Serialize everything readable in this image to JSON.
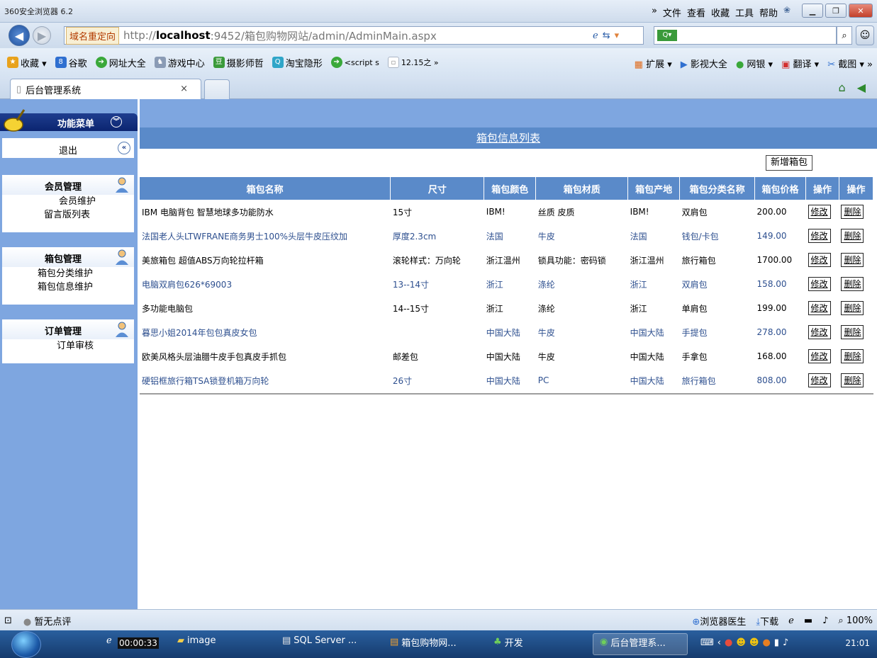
{
  "browser": {
    "title": "360安全浏览器 6.2",
    "menus": [
      "»",
      "文件",
      "查看",
      "收藏",
      "工具",
      "帮助"
    ],
    "redirect_label": "域名重定向",
    "url_pre": "http://",
    "url_host": "localhost",
    "url_rest": ":9452/箱包购物网站/admin/AdminMain.aspx",
    "favorites": [
      {
        "label": "收藏 ▾",
        "icon": "star-icon",
        "color": "#e8a21c"
      },
      {
        "label": "谷歌",
        "icon": "google-icon",
        "color": "#2f6fd0"
      },
      {
        "label": "网址大全",
        "icon": "web-icon",
        "color": "#3aa83a"
      },
      {
        "label": "游戏中心",
        "icon": "game-icon",
        "color": "#8a9bb5"
      },
      {
        "label": "摄影师哲",
        "icon": "douban-icon",
        "color": "#3a9a3a"
      },
      {
        "label": "淘宝隐形",
        "icon": "taobao-icon",
        "color": "#2fa5c8"
      },
      {
        "label": "<script s",
        "icon": "web-icon",
        "color": "#3aa83a"
      },
      {
        "label": "12.15之 »",
        "icon": "page-icon",
        "color": "#aab5c5"
      }
    ],
    "fav_right": [
      "扩展 ▾",
      "影视大全",
      "网银 ▾",
      "翻译 ▾",
      "截图 ▾ »"
    ],
    "tab_label": "后台管理系统",
    "tab_close": "×"
  },
  "sidebar": {
    "header": "功能菜单",
    "logout": "退出",
    "groups": [
      {
        "title": "会员管理",
        "items": [
          "会员维护",
          "留言版列表"
        ]
      },
      {
        "title": "箱包管理",
        "items": [
          "箱包分类维护",
          "箱包信息维护"
        ]
      },
      {
        "title": "订单管理",
        "items": [
          "订单审核"
        ]
      }
    ]
  },
  "main": {
    "list_title": "箱包信息列表",
    "add_button": "新增箱包",
    "columns": [
      "箱包名称",
      "尺寸",
      "箱包颜色",
      "箱包材质",
      "箱包产地",
      "箱包分类名称",
      "箱包价格",
      "操作",
      "操作"
    ],
    "edit_label": "修改",
    "delete_label": "删除",
    "rows": [
      [
        "IBM 电脑背包 智慧地球多功能防水",
        "15寸",
        "IBM!",
        "丝质 皮质",
        "IBM!",
        "双肩包",
        "200.00"
      ],
      [
        "法国老人头LTWFRANE商务男士100%头层牛皮压纹加",
        "厚度2.3cm",
        "法国",
        "牛皮",
        "法国",
        "钱包/卡包",
        "149.00"
      ],
      [
        "美旅箱包 超值ABS万向轮拉杆箱",
        "滚轮样式：万向轮",
        "浙江温州",
        "锁具功能：密码锁",
        "浙江温州",
        "旅行箱包",
        "1700.00"
      ],
      [
        "电脑双肩包626*69003",
        "13--14寸",
        "浙江",
        "涤纶",
        "浙江",
        "双肩包",
        "158.00"
      ],
      [
        "多功能电脑包",
        "14--15寸",
        "浙江",
        "涤纶",
        "浙江",
        "单肩包",
        "199.00"
      ],
      [
        "暮思小姐2014年包包真皮女包",
        "",
        "中国大陆",
        "牛皮",
        "中国大陆",
        "手提包",
        "278.00"
      ],
      [
        "欧美风格头层油腊牛皮手包真皮手抓包",
        "邮差包",
        "中国大陆",
        "牛皮",
        "中国大陆",
        "手拿包",
        "168.00"
      ],
      [
        "硬铝框旅行箱TSA锁登机箱万向轮",
        "26寸",
        "中国大陆",
        "PC",
        "中国大陆",
        "旅行箱包",
        "808.00"
      ]
    ]
  },
  "statusbar": {
    "rating": "暂无点评",
    "doctor": "浏览器医生",
    "download": "下载",
    "zoom": "100%"
  },
  "taskbar": {
    "timer": "00:00:33",
    "items": [
      "image",
      "SQL Server ...",
      "箱包购物网...",
      "开发",
      "后台管理系..."
    ],
    "clock": "21:01"
  }
}
